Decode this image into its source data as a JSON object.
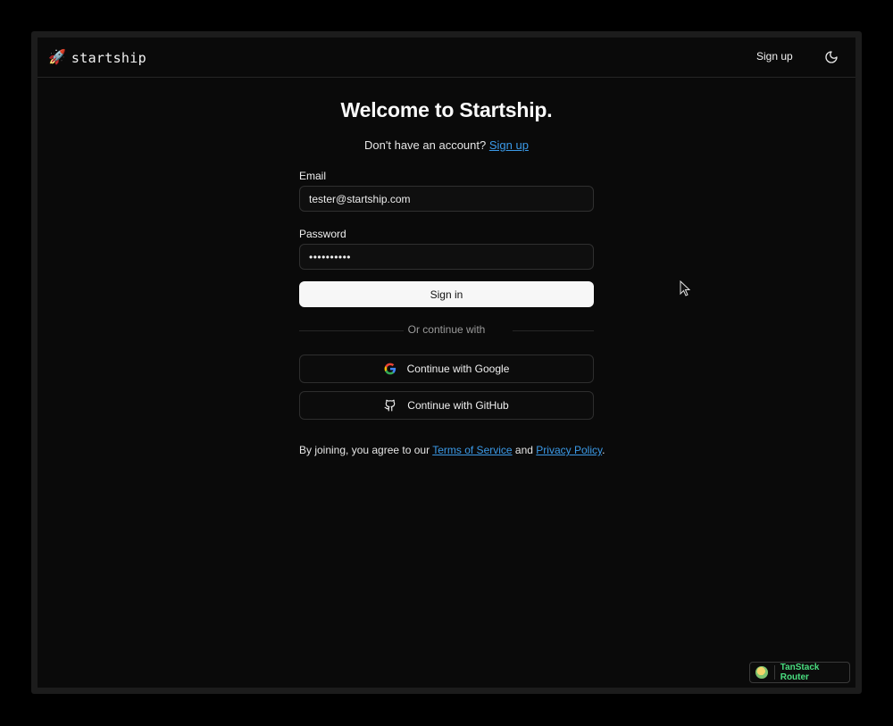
{
  "brand": {
    "icon": "rocket-icon",
    "name": "startship"
  },
  "navbar": {
    "signup_label": "Sign up",
    "theme_toggle_icon": "moon-icon"
  },
  "hero": {
    "title": "Welcome to Startship.",
    "subtitle_prefix": "Don't have an account?",
    "subtitle_link": "Sign up"
  },
  "form": {
    "email_label": "Email",
    "email_value": "tester@startship.com",
    "password_label": "Password",
    "password_value": "••••••••••",
    "signin_label": "Sign in",
    "divider_text": "Or continue with"
  },
  "oauth": {
    "google_label": "Continue with Google",
    "github_label": "Continue with GitHub"
  },
  "terms": {
    "prefix": "By joining, you agree to our",
    "tos_link": "Terms of Service",
    "and": "and",
    "privacy_link": "Privacy Policy",
    "suffix": "."
  },
  "devtools": {
    "label": "TanStack Router"
  },
  "colors": {
    "background": "#0a0a0a",
    "link": "#3b9ae8",
    "primary_button": "#f7f7f7",
    "badge_text": "#4ade80"
  }
}
